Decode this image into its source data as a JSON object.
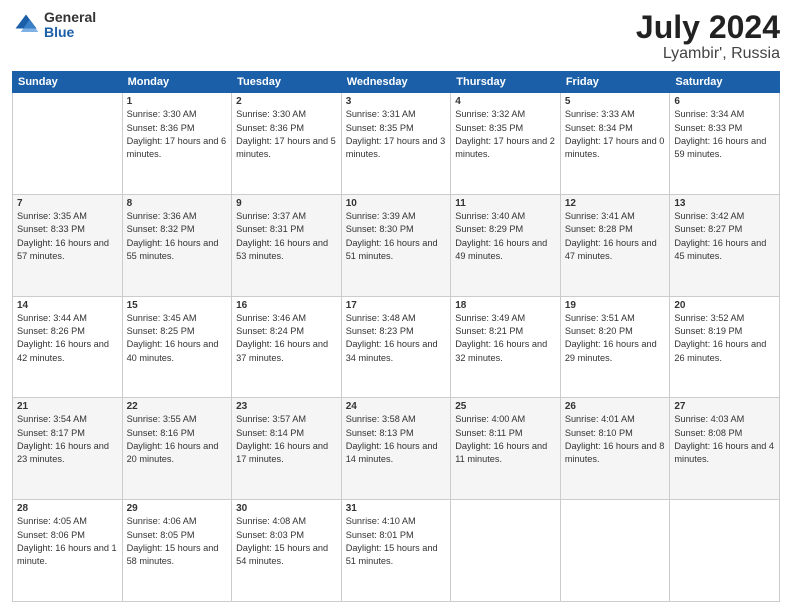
{
  "header": {
    "logo_general": "General",
    "logo_blue": "Blue",
    "title": "July 2024",
    "location": "Lyambir', Russia"
  },
  "days_of_week": [
    "Sunday",
    "Monday",
    "Tuesday",
    "Wednesday",
    "Thursday",
    "Friday",
    "Saturday"
  ],
  "weeks": [
    [
      {
        "day": "",
        "sunrise": "",
        "sunset": "",
        "daylight": ""
      },
      {
        "day": "1",
        "sunrise": "Sunrise: 3:30 AM",
        "sunset": "Sunset: 8:36 PM",
        "daylight": "Daylight: 17 hours and 6 minutes."
      },
      {
        "day": "2",
        "sunrise": "Sunrise: 3:30 AM",
        "sunset": "Sunset: 8:36 PM",
        "daylight": "Daylight: 17 hours and 5 minutes."
      },
      {
        "day": "3",
        "sunrise": "Sunrise: 3:31 AM",
        "sunset": "Sunset: 8:35 PM",
        "daylight": "Daylight: 17 hours and 3 minutes."
      },
      {
        "day": "4",
        "sunrise": "Sunrise: 3:32 AM",
        "sunset": "Sunset: 8:35 PM",
        "daylight": "Daylight: 17 hours and 2 minutes."
      },
      {
        "day": "5",
        "sunrise": "Sunrise: 3:33 AM",
        "sunset": "Sunset: 8:34 PM",
        "daylight": "Daylight: 17 hours and 0 minutes."
      },
      {
        "day": "6",
        "sunrise": "Sunrise: 3:34 AM",
        "sunset": "Sunset: 8:33 PM",
        "daylight": "Daylight: 16 hours and 59 minutes."
      }
    ],
    [
      {
        "day": "7",
        "sunrise": "Sunrise: 3:35 AM",
        "sunset": "Sunset: 8:33 PM",
        "daylight": "Daylight: 16 hours and 57 minutes."
      },
      {
        "day": "8",
        "sunrise": "Sunrise: 3:36 AM",
        "sunset": "Sunset: 8:32 PM",
        "daylight": "Daylight: 16 hours and 55 minutes."
      },
      {
        "day": "9",
        "sunrise": "Sunrise: 3:37 AM",
        "sunset": "Sunset: 8:31 PM",
        "daylight": "Daylight: 16 hours and 53 minutes."
      },
      {
        "day": "10",
        "sunrise": "Sunrise: 3:39 AM",
        "sunset": "Sunset: 8:30 PM",
        "daylight": "Daylight: 16 hours and 51 minutes."
      },
      {
        "day": "11",
        "sunrise": "Sunrise: 3:40 AM",
        "sunset": "Sunset: 8:29 PM",
        "daylight": "Daylight: 16 hours and 49 minutes."
      },
      {
        "day": "12",
        "sunrise": "Sunrise: 3:41 AM",
        "sunset": "Sunset: 8:28 PM",
        "daylight": "Daylight: 16 hours and 47 minutes."
      },
      {
        "day": "13",
        "sunrise": "Sunrise: 3:42 AM",
        "sunset": "Sunset: 8:27 PM",
        "daylight": "Daylight: 16 hours and 45 minutes."
      }
    ],
    [
      {
        "day": "14",
        "sunrise": "Sunrise: 3:44 AM",
        "sunset": "Sunset: 8:26 PM",
        "daylight": "Daylight: 16 hours and 42 minutes."
      },
      {
        "day": "15",
        "sunrise": "Sunrise: 3:45 AM",
        "sunset": "Sunset: 8:25 PM",
        "daylight": "Daylight: 16 hours and 40 minutes."
      },
      {
        "day": "16",
        "sunrise": "Sunrise: 3:46 AM",
        "sunset": "Sunset: 8:24 PM",
        "daylight": "Daylight: 16 hours and 37 minutes."
      },
      {
        "day": "17",
        "sunrise": "Sunrise: 3:48 AM",
        "sunset": "Sunset: 8:23 PM",
        "daylight": "Daylight: 16 hours and 34 minutes."
      },
      {
        "day": "18",
        "sunrise": "Sunrise: 3:49 AM",
        "sunset": "Sunset: 8:21 PM",
        "daylight": "Daylight: 16 hours and 32 minutes."
      },
      {
        "day": "19",
        "sunrise": "Sunrise: 3:51 AM",
        "sunset": "Sunset: 8:20 PM",
        "daylight": "Daylight: 16 hours and 29 minutes."
      },
      {
        "day": "20",
        "sunrise": "Sunrise: 3:52 AM",
        "sunset": "Sunset: 8:19 PM",
        "daylight": "Daylight: 16 hours and 26 minutes."
      }
    ],
    [
      {
        "day": "21",
        "sunrise": "Sunrise: 3:54 AM",
        "sunset": "Sunset: 8:17 PM",
        "daylight": "Daylight: 16 hours and 23 minutes."
      },
      {
        "day": "22",
        "sunrise": "Sunrise: 3:55 AM",
        "sunset": "Sunset: 8:16 PM",
        "daylight": "Daylight: 16 hours and 20 minutes."
      },
      {
        "day": "23",
        "sunrise": "Sunrise: 3:57 AM",
        "sunset": "Sunset: 8:14 PM",
        "daylight": "Daylight: 16 hours and 17 minutes."
      },
      {
        "day": "24",
        "sunrise": "Sunrise: 3:58 AM",
        "sunset": "Sunset: 8:13 PM",
        "daylight": "Daylight: 16 hours and 14 minutes."
      },
      {
        "day": "25",
        "sunrise": "Sunrise: 4:00 AM",
        "sunset": "Sunset: 8:11 PM",
        "daylight": "Daylight: 16 hours and 11 minutes."
      },
      {
        "day": "26",
        "sunrise": "Sunrise: 4:01 AM",
        "sunset": "Sunset: 8:10 PM",
        "daylight": "Daylight: 16 hours and 8 minutes."
      },
      {
        "day": "27",
        "sunrise": "Sunrise: 4:03 AM",
        "sunset": "Sunset: 8:08 PM",
        "daylight": "Daylight: 16 hours and 4 minutes."
      }
    ],
    [
      {
        "day": "28",
        "sunrise": "Sunrise: 4:05 AM",
        "sunset": "Sunset: 8:06 PM",
        "daylight": "Daylight: 16 hours and 1 minute."
      },
      {
        "day": "29",
        "sunrise": "Sunrise: 4:06 AM",
        "sunset": "Sunset: 8:05 PM",
        "daylight": "Daylight: 15 hours and 58 minutes."
      },
      {
        "day": "30",
        "sunrise": "Sunrise: 4:08 AM",
        "sunset": "Sunset: 8:03 PM",
        "daylight": "Daylight: 15 hours and 54 minutes."
      },
      {
        "day": "31",
        "sunrise": "Sunrise: 4:10 AM",
        "sunset": "Sunset: 8:01 PM",
        "daylight": "Daylight: 15 hours and 51 minutes."
      },
      {
        "day": "",
        "sunrise": "",
        "sunset": "",
        "daylight": ""
      },
      {
        "day": "",
        "sunrise": "",
        "sunset": "",
        "daylight": ""
      },
      {
        "day": "",
        "sunrise": "",
        "sunset": "",
        "daylight": ""
      }
    ]
  ]
}
